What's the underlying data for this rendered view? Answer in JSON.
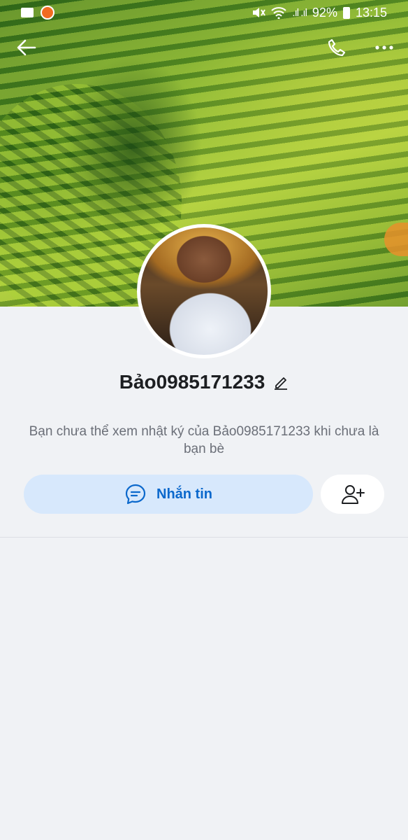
{
  "status_bar": {
    "battery": "92%",
    "time": "13:15",
    "signal_glyphs": ".ıl .ıl"
  },
  "profile": {
    "display_name": "Bảo0985171233",
    "notice": "Bạn chưa thể xem nhật ký của Bảo0985171233 khi chưa là bạn bè"
  },
  "actions": {
    "message_label": "Nhắn tin"
  },
  "colors": {
    "accent": "#0b68cc",
    "message_button_bg": "#d7e8fc",
    "page_bg": "#f0f2f5"
  },
  "icons": {
    "back": "back-arrow-icon",
    "call": "phone-icon",
    "more": "more-dots-icon",
    "edit": "pencil-icon",
    "chat": "chat-bubble-icon",
    "add_friend": "add-user-icon"
  }
}
